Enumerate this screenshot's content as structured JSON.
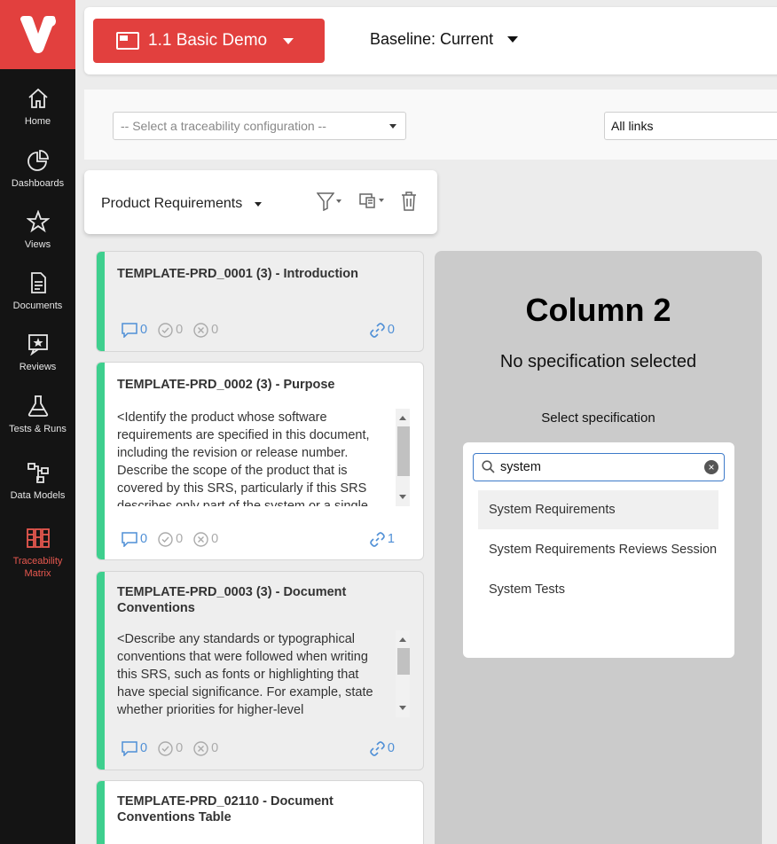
{
  "sidebar": {
    "items": [
      {
        "label": "Home",
        "icon": "home-icon"
      },
      {
        "label": "Dashboards",
        "icon": "pie-chart-icon"
      },
      {
        "label": "Views",
        "icon": "star-icon"
      },
      {
        "label": "Documents",
        "icon": "document-icon"
      },
      {
        "label": "Reviews",
        "icon": "review-icon"
      },
      {
        "label": "Tests & Runs",
        "icon": "flask-icon"
      },
      {
        "label": "Data Models",
        "icon": "data-model-icon"
      },
      {
        "label": "Traceability\nMatrix",
        "icon": "traceability-matrix-icon",
        "active": true
      }
    ]
  },
  "topbar": {
    "project_label": "1.1 Basic Demo",
    "baseline_label": "Baseline: Current"
  },
  "filters": {
    "trace_config_placeholder": "-- Select a traceability configuration --",
    "links_value": "All links"
  },
  "column1": {
    "title": "Product Requirements",
    "cards": [
      {
        "title": "TEMPLATE-PRD_0001 (3) - Introduction",
        "body": "",
        "comments": "0",
        "approvals": "0",
        "rejections": "0",
        "links": "0"
      },
      {
        "title": "TEMPLATE-PRD_0002 (3) - Purpose",
        "body": "<Identify the product whose software requirements are specified in this document, including the revision or release number. Describe the scope of the product that is covered by this SRS, particularly if this SRS describes only part of the system or a single",
        "comments": "0",
        "approvals": "0",
        "rejections": "0",
        "links": "1"
      },
      {
        "title": "TEMPLATE-PRD_0003 (3) - Document Conventions",
        "body": "<Describe any standards or typographical conventions that were followed when writing this SRS, such as fonts or highlighting that have special significance. For example, state whether priorities for higher-level",
        "comments": "0",
        "approvals": "0",
        "rejections": "0",
        "links": "0"
      },
      {
        "title": "TEMPLATE-PRD_02110 - Document Conventions Table",
        "body": ""
      }
    ]
  },
  "column2": {
    "title": "Column 2",
    "subtitle": "No specification selected",
    "select_label": "Select specification",
    "search_value": "system",
    "options": [
      "System Requirements",
      "System Requirements Reviews Session",
      "System Tests"
    ]
  },
  "colors": {
    "brand_red": "#e2403e",
    "stripe_green": "#3ecf8e",
    "link_blue": "#4f8fd6",
    "sidebar_bg": "#141414"
  }
}
